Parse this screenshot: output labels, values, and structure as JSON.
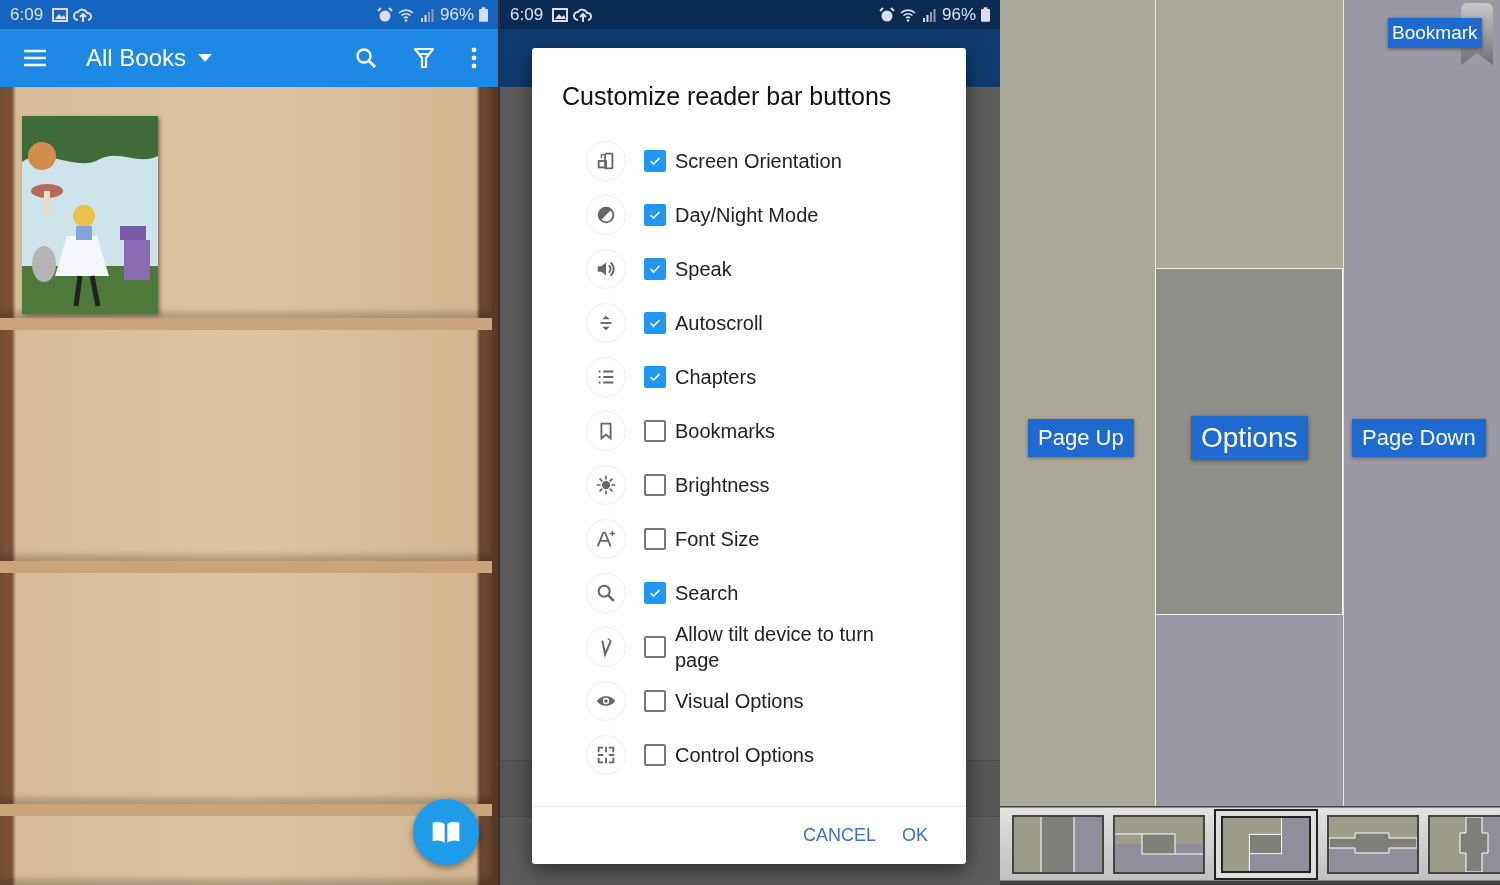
{
  "library_screen": {
    "status_bar": {
      "time": "6:09",
      "battery": "96%"
    },
    "toolbar": {
      "title": "All Books"
    }
  },
  "reader_screen": {
    "status_bar": {
      "time": "6:09",
      "battery": "96%"
    },
    "dialog": {
      "title": "Customize reader bar buttons",
      "options": [
        {
          "label": "Screen Orientation",
          "checked": true
        },
        {
          "label": "Day/Night Mode",
          "checked": true
        },
        {
          "label": "Speak",
          "checked": true
        },
        {
          "label": "Autoscroll",
          "checked": true
        },
        {
          "label": "Chapters",
          "checked": true
        },
        {
          "label": "Bookmarks",
          "checked": false
        },
        {
          "label": "Brightness",
          "checked": false
        },
        {
          "label": "Font Size",
          "checked": false
        },
        {
          "label": "Search",
          "checked": true
        },
        {
          "label": "Allow tilt device to turn page",
          "checked": false
        },
        {
          "label": "Visual Options",
          "checked": false
        },
        {
          "label": "Control Options",
          "checked": false
        }
      ],
      "buttons": [
        "CANCEL",
        "OK"
      ]
    }
  },
  "tap_zones_screen": {
    "bookmark": "Bookmark",
    "zones": [
      {
        "label": "Page Up"
      },
      {
        "label": "Options"
      },
      {
        "label": "Page Down"
      }
    ],
    "layouts": [
      {
        "kind": "columns",
        "selected": false
      },
      {
        "kind": "tee",
        "selected": false
      },
      {
        "kind": "corner",
        "selected": true
      },
      {
        "kind": "cross_h",
        "selected": false
      },
      {
        "kind": "cross_v",
        "selected": false
      }
    ]
  }
}
